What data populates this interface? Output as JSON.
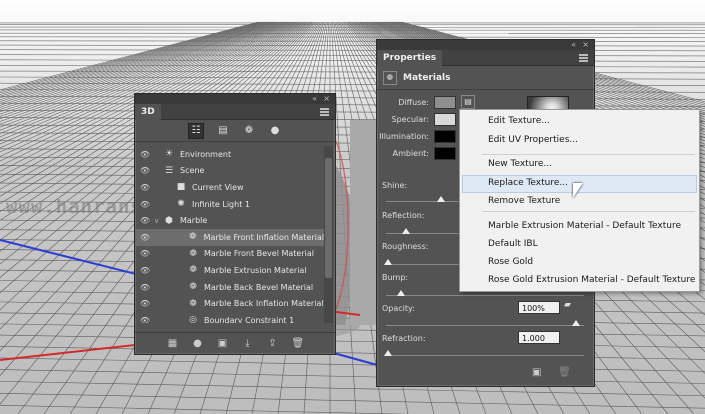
{
  "watermark": "www.hanranshejr.com",
  "panel3d": {
    "tab": "3D",
    "rows": [
      {
        "label": "Environment",
        "icon": "environment-icon",
        "glyph": "☀",
        "indent": 0,
        "caret": "",
        "state": ""
      },
      {
        "label": "Scene",
        "icon": "scene-icon",
        "glyph": "☰",
        "indent": 0,
        "caret": "",
        "state": ""
      },
      {
        "label": "Current View",
        "icon": "camera-icon",
        "glyph": "■",
        "indent": 1,
        "caret": "",
        "state": ""
      },
      {
        "label": "Infinite Light 1",
        "icon": "light-icon",
        "glyph": "✺",
        "indent": 1,
        "caret": "",
        "state": ""
      },
      {
        "label": "Marble",
        "icon": "mesh-icon",
        "glyph": "⬢",
        "indent": 0,
        "caret": "∨",
        "state": ""
      },
      {
        "label": "Marble Front Inflation Material",
        "icon": "material-icon",
        "glyph": "❁",
        "indent": 2,
        "caret": "",
        "state": "sel"
      },
      {
        "label": "Marble Front Bevel Material",
        "icon": "material-icon",
        "glyph": "❁",
        "indent": 2,
        "caret": "",
        "state": ""
      },
      {
        "label": "Marble Extrusion Material",
        "icon": "material-icon",
        "glyph": "❁",
        "indent": 2,
        "caret": "",
        "state": ""
      },
      {
        "label": "Marble Back Bevel Material",
        "icon": "material-icon",
        "glyph": "❁",
        "indent": 2,
        "caret": "",
        "state": ""
      },
      {
        "label": "Marble Back Inflation Material",
        "icon": "material-icon",
        "glyph": "❁",
        "indent": 2,
        "caret": "",
        "state": ""
      },
      {
        "label": "Boundary Constraint 1",
        "icon": "constraint-icon",
        "glyph": "◎",
        "indent": 2,
        "caret": "",
        "state": ""
      }
    ]
  },
  "properties": {
    "tab": "Properties",
    "header": "Materials",
    "labels": {
      "diffuse": "Diffuse:",
      "specular": "Specular:",
      "illumination": "Illumination:",
      "ambient": "Ambient:",
      "shine": "Shine:",
      "reflection": "Reflection:",
      "roughness": "Roughness:",
      "bump": "Bump:",
      "opacity": "Opacity:",
      "refraction": "Refraction:"
    },
    "values": {
      "opacity": "100%",
      "refraction": "1.000"
    },
    "colors": {
      "diffuse": "#8e8e8e",
      "specular": "#d9d9d9",
      "illumination": "#000000",
      "ambient": "#000000"
    }
  },
  "context_menu": {
    "items": [
      "Edit Texture...",
      "Edit UV Properties...",
      "New Texture...",
      "Replace Texture...",
      "Remove Texture",
      "Marble Extrusion Material - Default Texture",
      "Default IBL",
      "Rose Gold",
      "Rose Gold Extrusion Material - Default Texture"
    ],
    "hovered": "Replace Texture..."
  }
}
